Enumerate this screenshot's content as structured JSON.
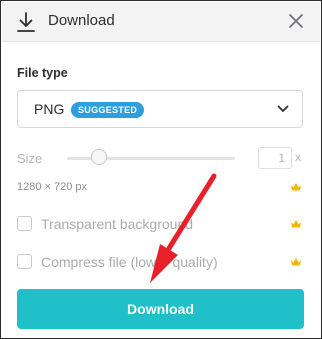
{
  "header": {
    "title": "Download",
    "icons": {
      "download": "download-icon",
      "close": "close-icon"
    }
  },
  "file_type": {
    "label": "File type",
    "selected": "PNG",
    "badge": "SUGGESTED",
    "icon": "chevron-down-icon"
  },
  "size": {
    "label": "Size",
    "slider_level": 0.2,
    "multiplier": "1",
    "suffix": "x",
    "dimensions": "1280 × 720 px",
    "premium_icon": "crown-icon"
  },
  "options": [
    {
      "label": "Transparent background",
      "checked": false,
      "premium_icon": "crown-icon"
    },
    {
      "label": "Compress file (lower quality)",
      "checked": false,
      "premium_icon": "crown-icon"
    }
  ],
  "download_button": {
    "label": "Download"
  },
  "colors": {
    "accent": "#1fc0c8",
    "badge": "#2d9fdc",
    "crown": "#f2b705",
    "annotation_arrow": "#e8202a"
  }
}
